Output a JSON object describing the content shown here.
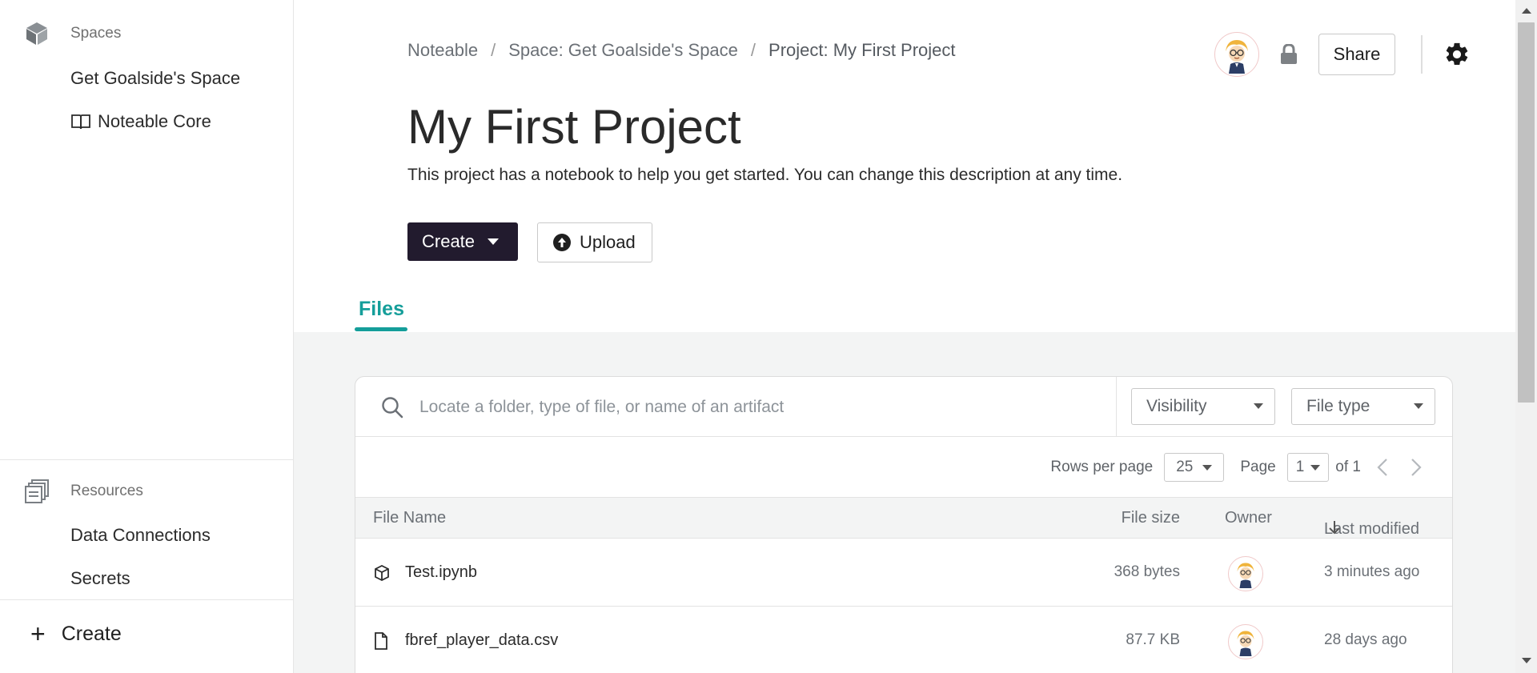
{
  "sidebar": {
    "spaces_title": "Spaces",
    "spaces": [
      {
        "label": "Get Goalside's Space"
      },
      {
        "label": "Noteable Core"
      }
    ],
    "resources_title": "Resources",
    "resources": [
      {
        "label": "Data Connections"
      },
      {
        "label": "Secrets"
      }
    ],
    "create_label": "Create"
  },
  "breadcrumb": {
    "root": "Noteable",
    "space": "Space: Get Goalside's Space",
    "project": "Project: My First Project",
    "separator": "/"
  },
  "header": {
    "share_label": "Share"
  },
  "project": {
    "title": "My First Project",
    "description": "This project has a notebook to help you get started. You can change this description at any time.",
    "create_label": "Create",
    "upload_label": "Upload"
  },
  "tabs": [
    {
      "label": "Files",
      "active": true
    }
  ],
  "files": {
    "search_placeholder": "Locate a folder, type of file, or name of an artifact",
    "visibility_label": "Visibility",
    "filetype_label": "File type",
    "rows_per_page_label": "Rows per page",
    "rows_per_page_value": "25",
    "page_label": "Page",
    "page_value": "1",
    "page_of": "of 1",
    "columns": {
      "name": "File Name",
      "size": "File size",
      "owner": "Owner",
      "modified": "Last modified"
    },
    "rows": [
      {
        "name": "Test.ipynb",
        "size": "368 bytes",
        "modified": "3 minutes ago",
        "icon": "notebook-icon"
      },
      {
        "name": "fbref_player_data.csv",
        "size": "87.7 KB",
        "modified": "28 days ago",
        "icon": "file-icon"
      }
    ]
  },
  "colors": {
    "accent": "#159e9a",
    "primary_button": "#221b2e",
    "content_bg": "#f3f4f4"
  }
}
